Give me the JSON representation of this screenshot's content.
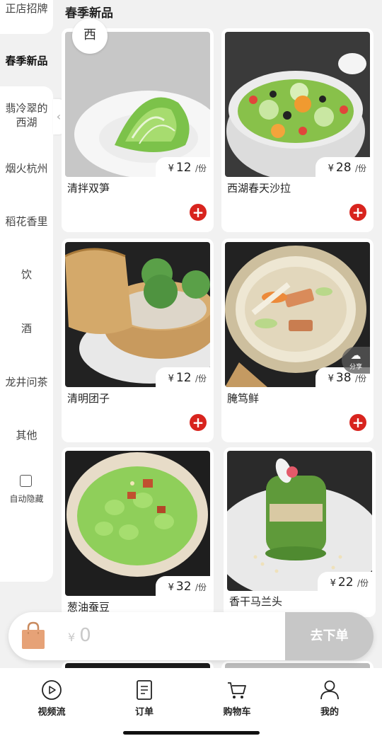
{
  "sidebar": {
    "items": [
      {
        "label": "正店招牌",
        "active": false
      },
      {
        "label": "春季新品",
        "active": true
      },
      {
        "label": "翡冷翠的西湖",
        "active": false
      },
      {
        "label": "烟火杭州",
        "active": false
      },
      {
        "label": "稻花香里",
        "active": false
      },
      {
        "label": "饮",
        "active": false
      },
      {
        "label": "酒",
        "active": false
      },
      {
        "label": "龙井问茶",
        "active": false
      },
      {
        "label": "其他",
        "active": false
      }
    ],
    "auto_hide_label": "自动隐藏",
    "auto_hide_checked": false
  },
  "section": {
    "title": "春季新品",
    "badge": "西"
  },
  "products": [
    {
      "name": "清拌双笋",
      "currency": "¥",
      "price": "12",
      "unit": "/份"
    },
    {
      "name": "西湖春天沙拉",
      "currency": "¥",
      "price": "28",
      "unit": "/份"
    },
    {
      "name": "清明团子",
      "currency": "¥",
      "price": "12",
      "unit": "/份"
    },
    {
      "name": "腌笃鲜",
      "currency": "¥",
      "price": "38",
      "unit": "/份"
    },
    {
      "name": "葱油蚕豆",
      "currency": "¥",
      "price": "32",
      "unit": "/份"
    },
    {
      "name": "香干马兰头",
      "currency": "¥",
      "price": "22",
      "unit": "/份"
    }
  ],
  "share_label": "分享",
  "cart": {
    "currency": "¥",
    "amount": "0",
    "checkout_label": "去下单"
  },
  "tabbar": [
    {
      "label": "视频流",
      "icon": "play-circle-icon"
    },
    {
      "label": "订单",
      "icon": "order-list-icon"
    },
    {
      "label": "购物车",
      "icon": "cart-icon"
    },
    {
      "label": "我的",
      "icon": "user-icon"
    }
  ],
  "colors": {
    "accent_red": "#d8241e",
    "checkout_gray": "#c7c7c7",
    "bag": "#e6a277"
  }
}
